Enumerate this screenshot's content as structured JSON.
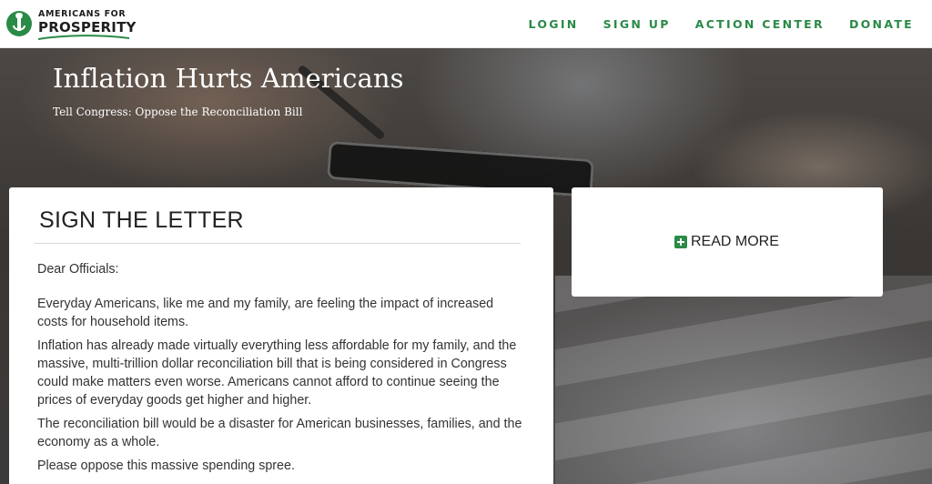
{
  "brand": {
    "line1": "AMERICANS FOR",
    "line2": "PROSPERITY",
    "green": "#2a8a47"
  },
  "nav": {
    "items": [
      {
        "label": "LOGIN"
      },
      {
        "label": "SIGN UP"
      },
      {
        "label": "ACTION CENTER"
      },
      {
        "label": "DONATE"
      }
    ]
  },
  "hero": {
    "title": "Inflation Hurts Americans",
    "subtitle": "Tell Congress: Oppose the Reconciliation Bill"
  },
  "letter": {
    "heading": "SIGN THE LETTER",
    "salutation": "Dear Officials:",
    "paragraphs": [
      "Everyday Americans, like me and my family, are feeling the impact of increased costs for household items.",
      "Inflation has already made virtually everything less affordable for my family, and the massive, multi-trillion dollar reconciliation bill that is being considered in Congress could make matters even worse. Americans cannot afford to continue seeing the prices of everyday goods get higher and higher.",
      "The reconciliation bill would be a disaster for American businesses, families, and the economy as a whole.",
      "Please oppose this massive spending spree."
    ]
  },
  "read_more": {
    "label": "READ MORE",
    "icon": "plus-square-icon"
  }
}
